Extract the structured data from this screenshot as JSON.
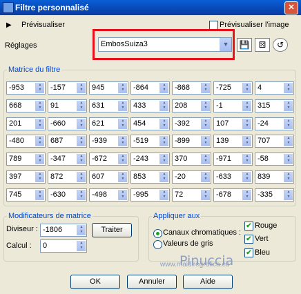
{
  "window": {
    "title": "Filtre personnalisé",
    "close_glyph": "✕"
  },
  "preview": {
    "arrow_glyph": "▶",
    "label": "Prévisualiser",
    "checkbox_label": "Prévisualiser l'image"
  },
  "reglages": {
    "label": "Réglages",
    "preset_value": "EmbosSuiza3",
    "dropdown_glyph": "▼"
  },
  "toolbar": {
    "save_icon_glyph": "💾",
    "randomize_icon_glyph": "⚄",
    "reset_icon_glyph": "↺"
  },
  "matrix": {
    "title": "Matrice du filtre",
    "rows": [
      [
        "-953",
        "-157",
        "945",
        "-864",
        "-868",
        "-725",
        "4"
      ],
      [
        "668",
        "91",
        "631",
        "433",
        "208",
        "-1",
        "315"
      ],
      [
        "201",
        "-660",
        "621",
        "454",
        "-392",
        "107",
        "-24"
      ],
      [
        "-480",
        "687",
        "-939",
        "-519",
        "-899",
        "139",
        "707"
      ],
      [
        "789",
        "-347",
        "-672",
        "-243",
        "370",
        "-971",
        "-58"
      ],
      [
        "397",
        "872",
        "607",
        "853",
        "-20",
        "-633",
        "839"
      ],
      [
        "745",
        "-630",
        "-498",
        "-995",
        "72",
        "-678",
        "-335"
      ]
    ]
  },
  "modifiers": {
    "title": "Modificateurs de matrice",
    "diviseur_label": "Diviseur :",
    "diviseur_value": "-1806",
    "traiter_label": "Traiter",
    "calcul_label": "Calcul :",
    "calcul_value": "0"
  },
  "apply": {
    "title": "Appliquer aux",
    "channels_label": "Canaux chromatiques :",
    "grays_label": "Valeurs de gris",
    "rouge_label": "Rouge",
    "vert_label": "Vert",
    "bleu_label": "Bleu",
    "check_glyph": "✔"
  },
  "watermark": {
    "name": "Pinuccia",
    "url": "www.maidiregrafica.eu"
  },
  "buttons": {
    "ok": "OK",
    "cancel": "Annuler",
    "help": "Aide"
  }
}
